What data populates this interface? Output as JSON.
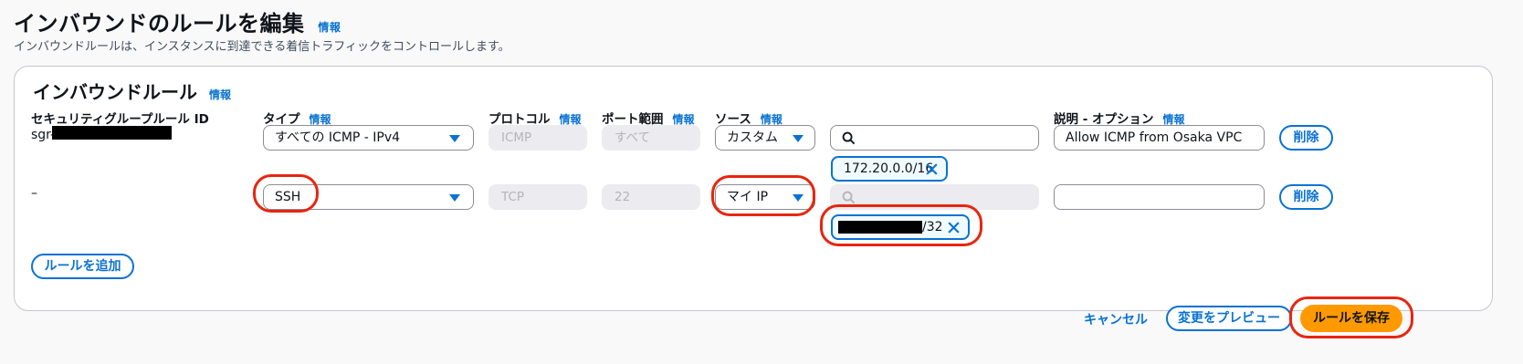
{
  "page": {
    "title": "インバウンドのルールを編集",
    "title_info": "情報",
    "subtitle": "インバウンドルールは、インスタンスに到達できる着信トラフィックをコントロールします。"
  },
  "section": {
    "title": "インバウンドルール",
    "info": "情報"
  },
  "columns": {
    "rule_id": "セキュリティグループルール ID",
    "type": "タイプ",
    "protocol": "プロトコル",
    "port_range": "ポート範囲",
    "source": "ソース",
    "description": "説明 - オプション",
    "info": "情報"
  },
  "rules": [
    {
      "id_prefix": "sgr-",
      "type": "すべての ICMP - IPv4",
      "protocol": "ICMP",
      "port": "すべて",
      "source_mode": "カスタム",
      "cidr": "172.20.0.0/16",
      "description": "Allow ICMP from Osaka VPC",
      "delete_label": "削除"
    },
    {
      "id_prefix": "–",
      "type": "SSH",
      "protocol": "TCP",
      "port": "22",
      "source_mode": "マイ IP",
      "cidr_suffix": "/32",
      "description": "",
      "delete_label": "削除"
    }
  ],
  "actions": {
    "add_rule": "ルールを追加",
    "cancel": "キャンセル",
    "preview": "変更をプレビュー",
    "save": "ルールを保存"
  },
  "colors": {
    "accent": "#0972d3",
    "primary_button": "#ff9900",
    "highlight_ring": "#e8250f"
  }
}
